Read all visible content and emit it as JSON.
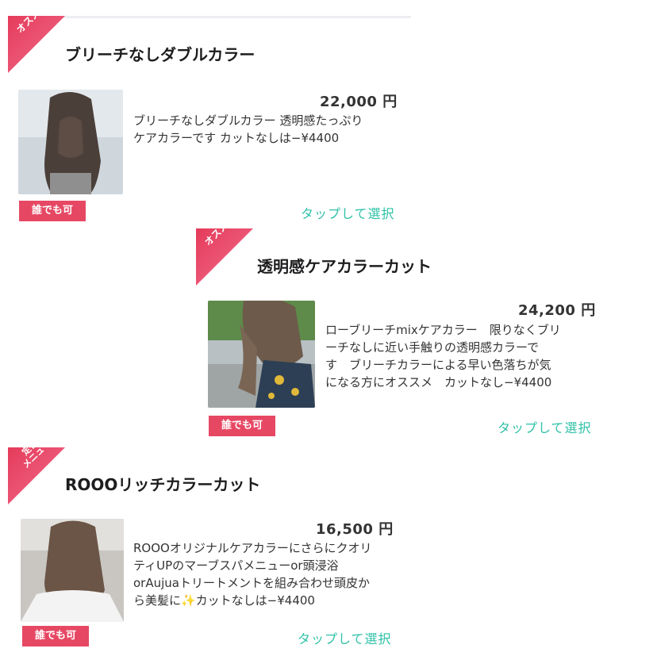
{
  "menu_items": [
    {
      "ribbon": "オススメ",
      "title": "ブリーチなしダブルカラー",
      "price": "22,000 円",
      "description": "ブリーチなしダブルカラー 透明感たっぷり\nケアカラーです カットなしは−¥4400",
      "badge": "誰でも可",
      "select_label": "タップして選択"
    },
    {
      "ribbon": "オススメ",
      "title": "透明感ケアカラーカット",
      "price": "24,200 円",
      "description": "ローブリーチmixケアカラー　限りなくブリ\nーチなしに近い手触りの透明感カラーで\nす　ブリーチカラーによる早い色落ちが気\nになる方にオススメ　カットなし−¥4400",
      "badge": "誰でも可",
      "select_label": "タップして選択"
    },
    {
      "ribbon": "定番\nメニュー",
      "title": "ROOOリッチカラーカット",
      "price": "16,500 円",
      "description": "ROOOオリジナルケアカラーにさらにクオリ\nティUPのマーブスパメニューor頭浸浴\norAujuaトリートメントを組み合わせ頭皮か\nら美髪に✨カットなしは−¥4400",
      "badge": "誰でも可",
      "select_label": "タップして選択"
    }
  ]
}
